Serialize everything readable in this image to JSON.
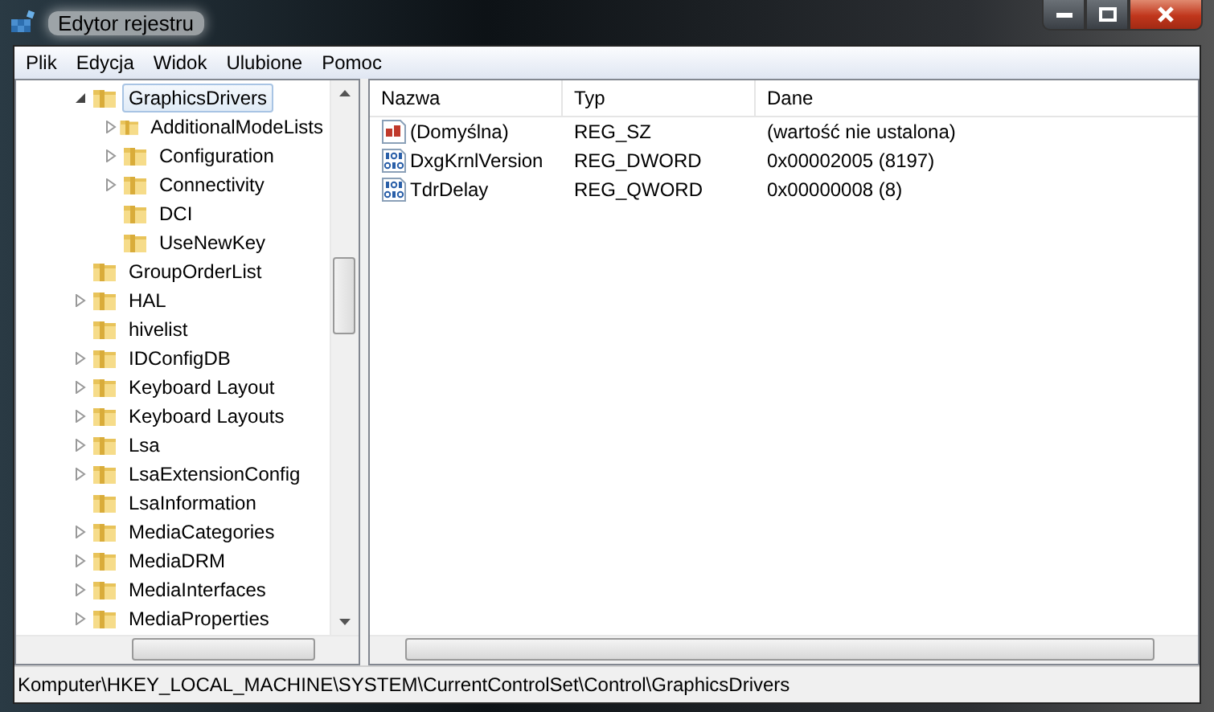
{
  "window": {
    "title": "Edytor rejestru"
  },
  "menu": [
    "Plik",
    "Edycja",
    "Widok",
    "Ulubione",
    "Pomoc"
  ],
  "tree": [
    {
      "label": "GraphicsDrivers",
      "kind": "branch",
      "expanded": true,
      "selected": true,
      "children": [
        {
          "label": "AdditionalModeLists",
          "kind": "branch",
          "expanded": false,
          "selected": false
        },
        {
          "label": "Configuration",
          "kind": "branch",
          "expanded": false,
          "selected": false
        },
        {
          "label": "Connectivity",
          "kind": "branch",
          "expanded": false,
          "selected": false
        },
        {
          "label": "DCI",
          "kind": "leaf",
          "selected": false
        },
        {
          "label": "UseNewKey",
          "kind": "leaf",
          "selected": false
        }
      ]
    },
    {
      "label": "GroupOrderList",
      "kind": "leaf",
      "selected": false
    },
    {
      "label": "HAL",
      "kind": "branch",
      "expanded": false,
      "selected": false
    },
    {
      "label": "hivelist",
      "kind": "leaf",
      "selected": false
    },
    {
      "label": "IDConfigDB",
      "kind": "branch",
      "expanded": false,
      "selected": false
    },
    {
      "label": "Keyboard Layout",
      "kind": "branch",
      "expanded": false,
      "selected": false
    },
    {
      "label": "Keyboard Layouts",
      "kind": "branch",
      "expanded": false,
      "selected": false
    },
    {
      "label": "Lsa",
      "kind": "branch",
      "expanded": false,
      "selected": false
    },
    {
      "label": "LsaExtensionConfig",
      "kind": "branch",
      "expanded": false,
      "selected": false
    },
    {
      "label": "LsaInformation",
      "kind": "leaf",
      "selected": false
    },
    {
      "label": "MediaCategories",
      "kind": "branch",
      "expanded": false,
      "selected": false
    },
    {
      "label": "MediaDRM",
      "kind": "branch",
      "expanded": false,
      "selected": false
    },
    {
      "label": "MediaInterfaces",
      "kind": "branch",
      "expanded": false,
      "selected": false
    },
    {
      "label": "MediaProperties",
      "kind": "branch",
      "expanded": false,
      "selected": false
    }
  ],
  "table": {
    "columns": [
      "Nazwa",
      "Typ",
      "Dane"
    ],
    "rows": [
      {
        "kind": "string",
        "name": "(Domyślna)",
        "type": "REG_SZ",
        "data": "(wartość nie ustalona)"
      },
      {
        "kind": "binary",
        "name": "DxgKrnlVersion",
        "type": "REG_DWORD",
        "data": "0x00002005 (8197)"
      },
      {
        "kind": "binary",
        "name": "TdrDelay",
        "type": "REG_QWORD",
        "data": "0x00000008 (8)"
      }
    ]
  },
  "status_bar": "Komputer\\HKEY_LOCAL_MACHINE\\SYSTEM\\CurrentControlSet\\Control\\GraphicsDrivers"
}
